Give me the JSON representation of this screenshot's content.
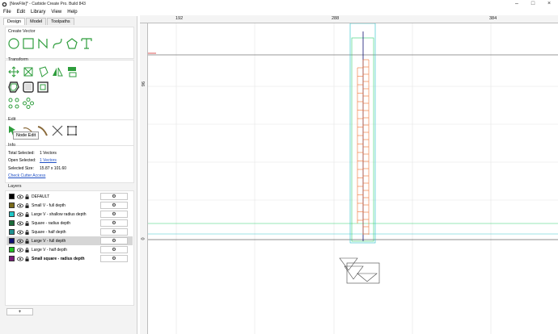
{
  "window": {
    "title": "[NewFile]* - Carbide Create Pro. Build 843"
  },
  "menu": [
    "File",
    "Edit",
    "Library",
    "View",
    "Help"
  ],
  "tabs": [
    "Design",
    "Model",
    "Toolpaths"
  ],
  "sections": {
    "create_vector": "Create Vector",
    "transform": "Transform",
    "edit": "Edit",
    "info": "Info",
    "layers": "Layers"
  },
  "create_vector_tools": [
    "circle-icon",
    "rectangle-icon",
    "polyline-icon",
    "curve-icon",
    "polygon-icon",
    "text-icon"
  ],
  "transform_tools": [
    "move-icon",
    "scale-icon",
    "rotate-icon",
    "mirror-icon",
    "align-icon",
    "offset-icon",
    "boolean-icon",
    "tab-icon",
    "array-icon",
    "circular-array-icon"
  ],
  "edit_tools": [
    "node-edit-icon",
    "draw-on-curve-icon",
    "trim-icon",
    "cut-icon",
    "join-icon"
  ],
  "tooltip": "Node Edit",
  "info": {
    "total_label": "Total Selected:",
    "total_value": "1 Vectors",
    "open_label": "Open Selected:",
    "open_value": "1 Vectors",
    "size_label": "Selected Size:",
    "size_value": "15.87 x 101.60",
    "check_link": "Check Cutter Access"
  },
  "layers": [
    {
      "name": "DEFAULT",
      "color": "#000000",
      "bold": false,
      "selected": false
    },
    {
      "name": "Small V - full depth",
      "color": "#7a6a1a",
      "bold": false,
      "selected": false
    },
    {
      "name": "Large V - shallow radius depth",
      "color": "#20c8c8",
      "bold": false,
      "selected": false
    },
    {
      "name": "Square - radius depth",
      "color": "#1b6b3a",
      "bold": false,
      "selected": false
    },
    {
      "name": "Square - half depth",
      "color": "#1e8f8f",
      "bold": false,
      "selected": false
    },
    {
      "name": "Large V - full depth",
      "color": "#101070",
      "bold": false,
      "selected": true
    },
    {
      "name": "Large V - half depth",
      "color": "#22c022",
      "bold": false,
      "selected": false
    },
    {
      "name": "Small square - radius depth",
      "color": "#7a1a7a",
      "bold": true,
      "selected": false
    }
  ],
  "add_layer_label": "+",
  "rulers": {
    "x": [
      "192",
      "288",
      "384"
    ],
    "y": [
      "96",
      "0"
    ]
  },
  "colors": {
    "accent": "#1f4fc4",
    "red_line": "#d02020",
    "cyan": "#40c8d0",
    "green": "#30d070",
    "orange": "#f07030"
  }
}
